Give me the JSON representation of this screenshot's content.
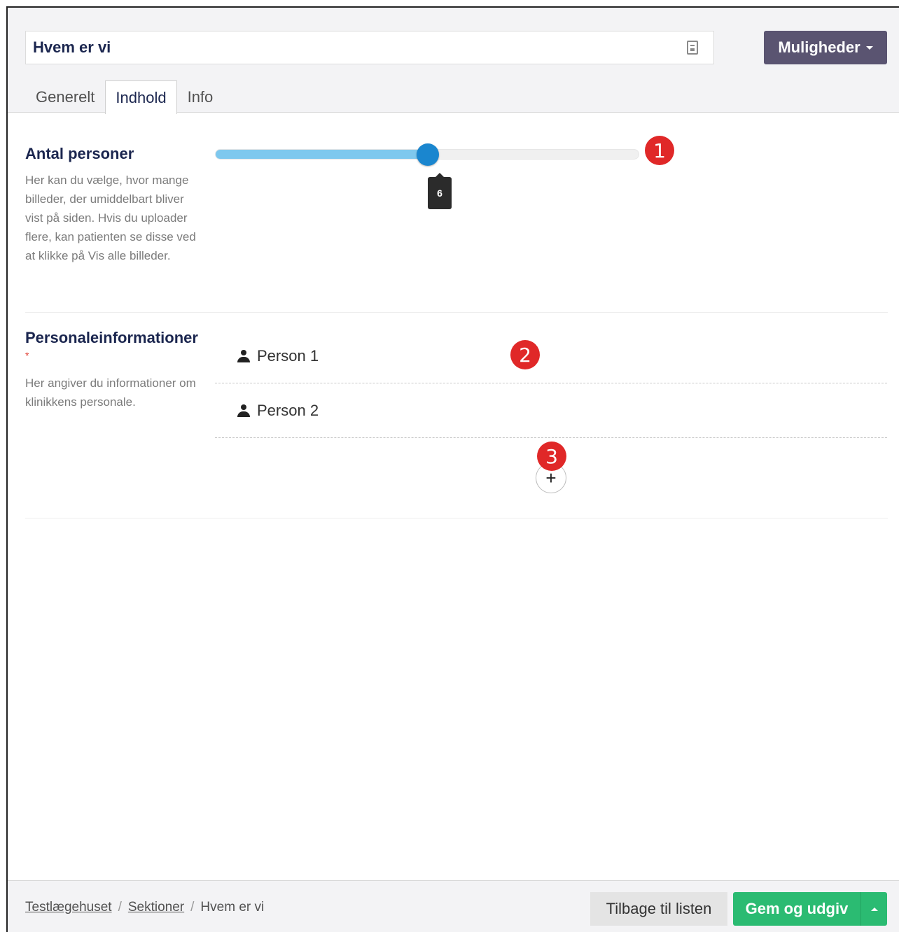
{
  "header": {
    "name_value": "Hvem er vi",
    "options_label": "Muligheder",
    "tabs": [
      {
        "label": "Generelt",
        "active": false
      },
      {
        "label": "Indhold",
        "active": true
      },
      {
        "label": "Info",
        "active": false
      }
    ]
  },
  "sections": {
    "count": {
      "title": "Antal personer",
      "description": "Her kan du vælge, hvor mange billeder, der umiddelbart bliver vist på siden. Hvis du uploader flere, kan patienten se disse ved at klikke på Vis alle billeder.",
      "slider_value": "6",
      "slider_fraction": 0.5
    },
    "staff": {
      "title": "Personaleinformationer",
      "required_mark": "*",
      "description": "Her angiver du informationer om klinikkens personale.",
      "persons": [
        "Person 1",
        "Person 2"
      ],
      "add_label": "+"
    }
  },
  "badges": [
    "1",
    "2",
    "3"
  ],
  "footer": {
    "breadcrumb": [
      "Testlægehuset",
      "Sektioner",
      "Hvem er vi"
    ],
    "separator": "/",
    "back_label": "Tilbage til listen",
    "save_label": "Gem og udgiv"
  },
  "colors": {
    "primary_purple": "#5a5471",
    "save_green": "#2bbb72",
    "slider_blue": "#1a86cf",
    "badge_red": "#e02828"
  },
  "icons": [
    "document-icon",
    "caret-down-icon",
    "user-icon",
    "plus-icon",
    "caret-up-icon"
  ]
}
